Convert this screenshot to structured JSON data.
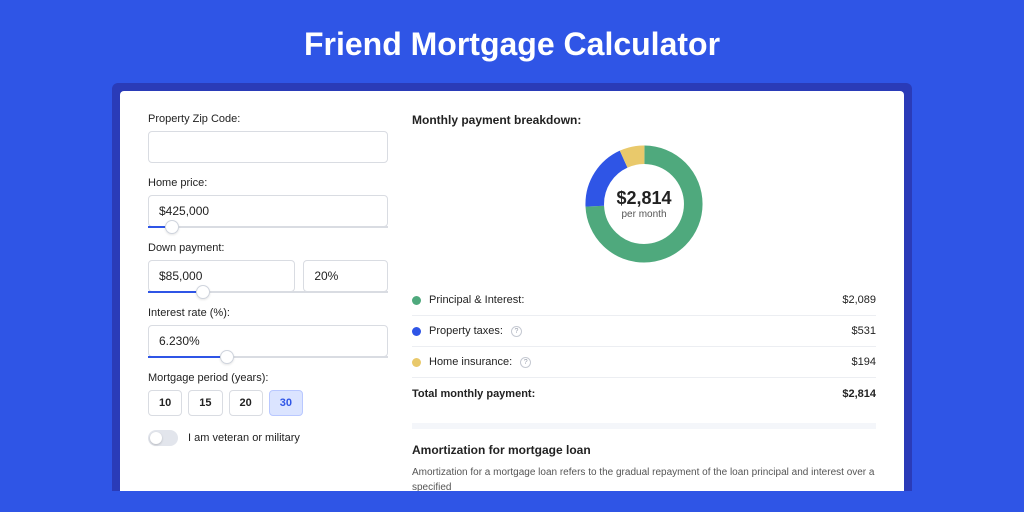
{
  "title": "Friend Mortgage Calculator",
  "form": {
    "zip_label": "Property Zip Code:",
    "zip_value": "",
    "price_label": "Home price:",
    "price_value": "$425,000",
    "price_slider_pct": 7,
    "dp_label": "Down payment:",
    "dp_amount": "$85,000",
    "dp_pct": "20%",
    "dp_slider_pct": 20,
    "rate_label": "Interest rate (%):",
    "rate_value": "6.230%",
    "rate_slider_pct": 30,
    "term_label": "Mortgage period (years):",
    "terms": [
      "10",
      "15",
      "20",
      "30"
    ],
    "term_selected": "30",
    "veteran_label": "I am veteran or military"
  },
  "breakdown": {
    "title": "Monthly payment breakdown:",
    "center_amount": "$2,814",
    "center_sub": "per month",
    "items": [
      {
        "color": "green",
        "label": "Principal & Interest:",
        "value": "$2,089",
        "info": false
      },
      {
        "color": "blue",
        "label": "Property taxes:",
        "value": "$531",
        "info": true
      },
      {
        "color": "yellow",
        "label": "Home insurance:",
        "value": "$194",
        "info": true
      }
    ],
    "total_label": "Total monthly payment:",
    "total_value": "$2,814"
  },
  "chart_data": {
    "type": "pie",
    "title": "Monthly payment breakdown",
    "series": [
      {
        "name": "Principal & Interest",
        "value": 2089,
        "color": "#4fa97d"
      },
      {
        "name": "Property taxes",
        "value": 531,
        "color": "#2f55e6"
      },
      {
        "name": "Home insurance",
        "value": 194,
        "color": "#e9c96b"
      }
    ],
    "total": 2814
  },
  "amortization": {
    "heading": "Amortization for mortgage loan",
    "text": "Amortization for a mortgage loan refers to the gradual repayment of the loan principal and interest over a specified"
  }
}
